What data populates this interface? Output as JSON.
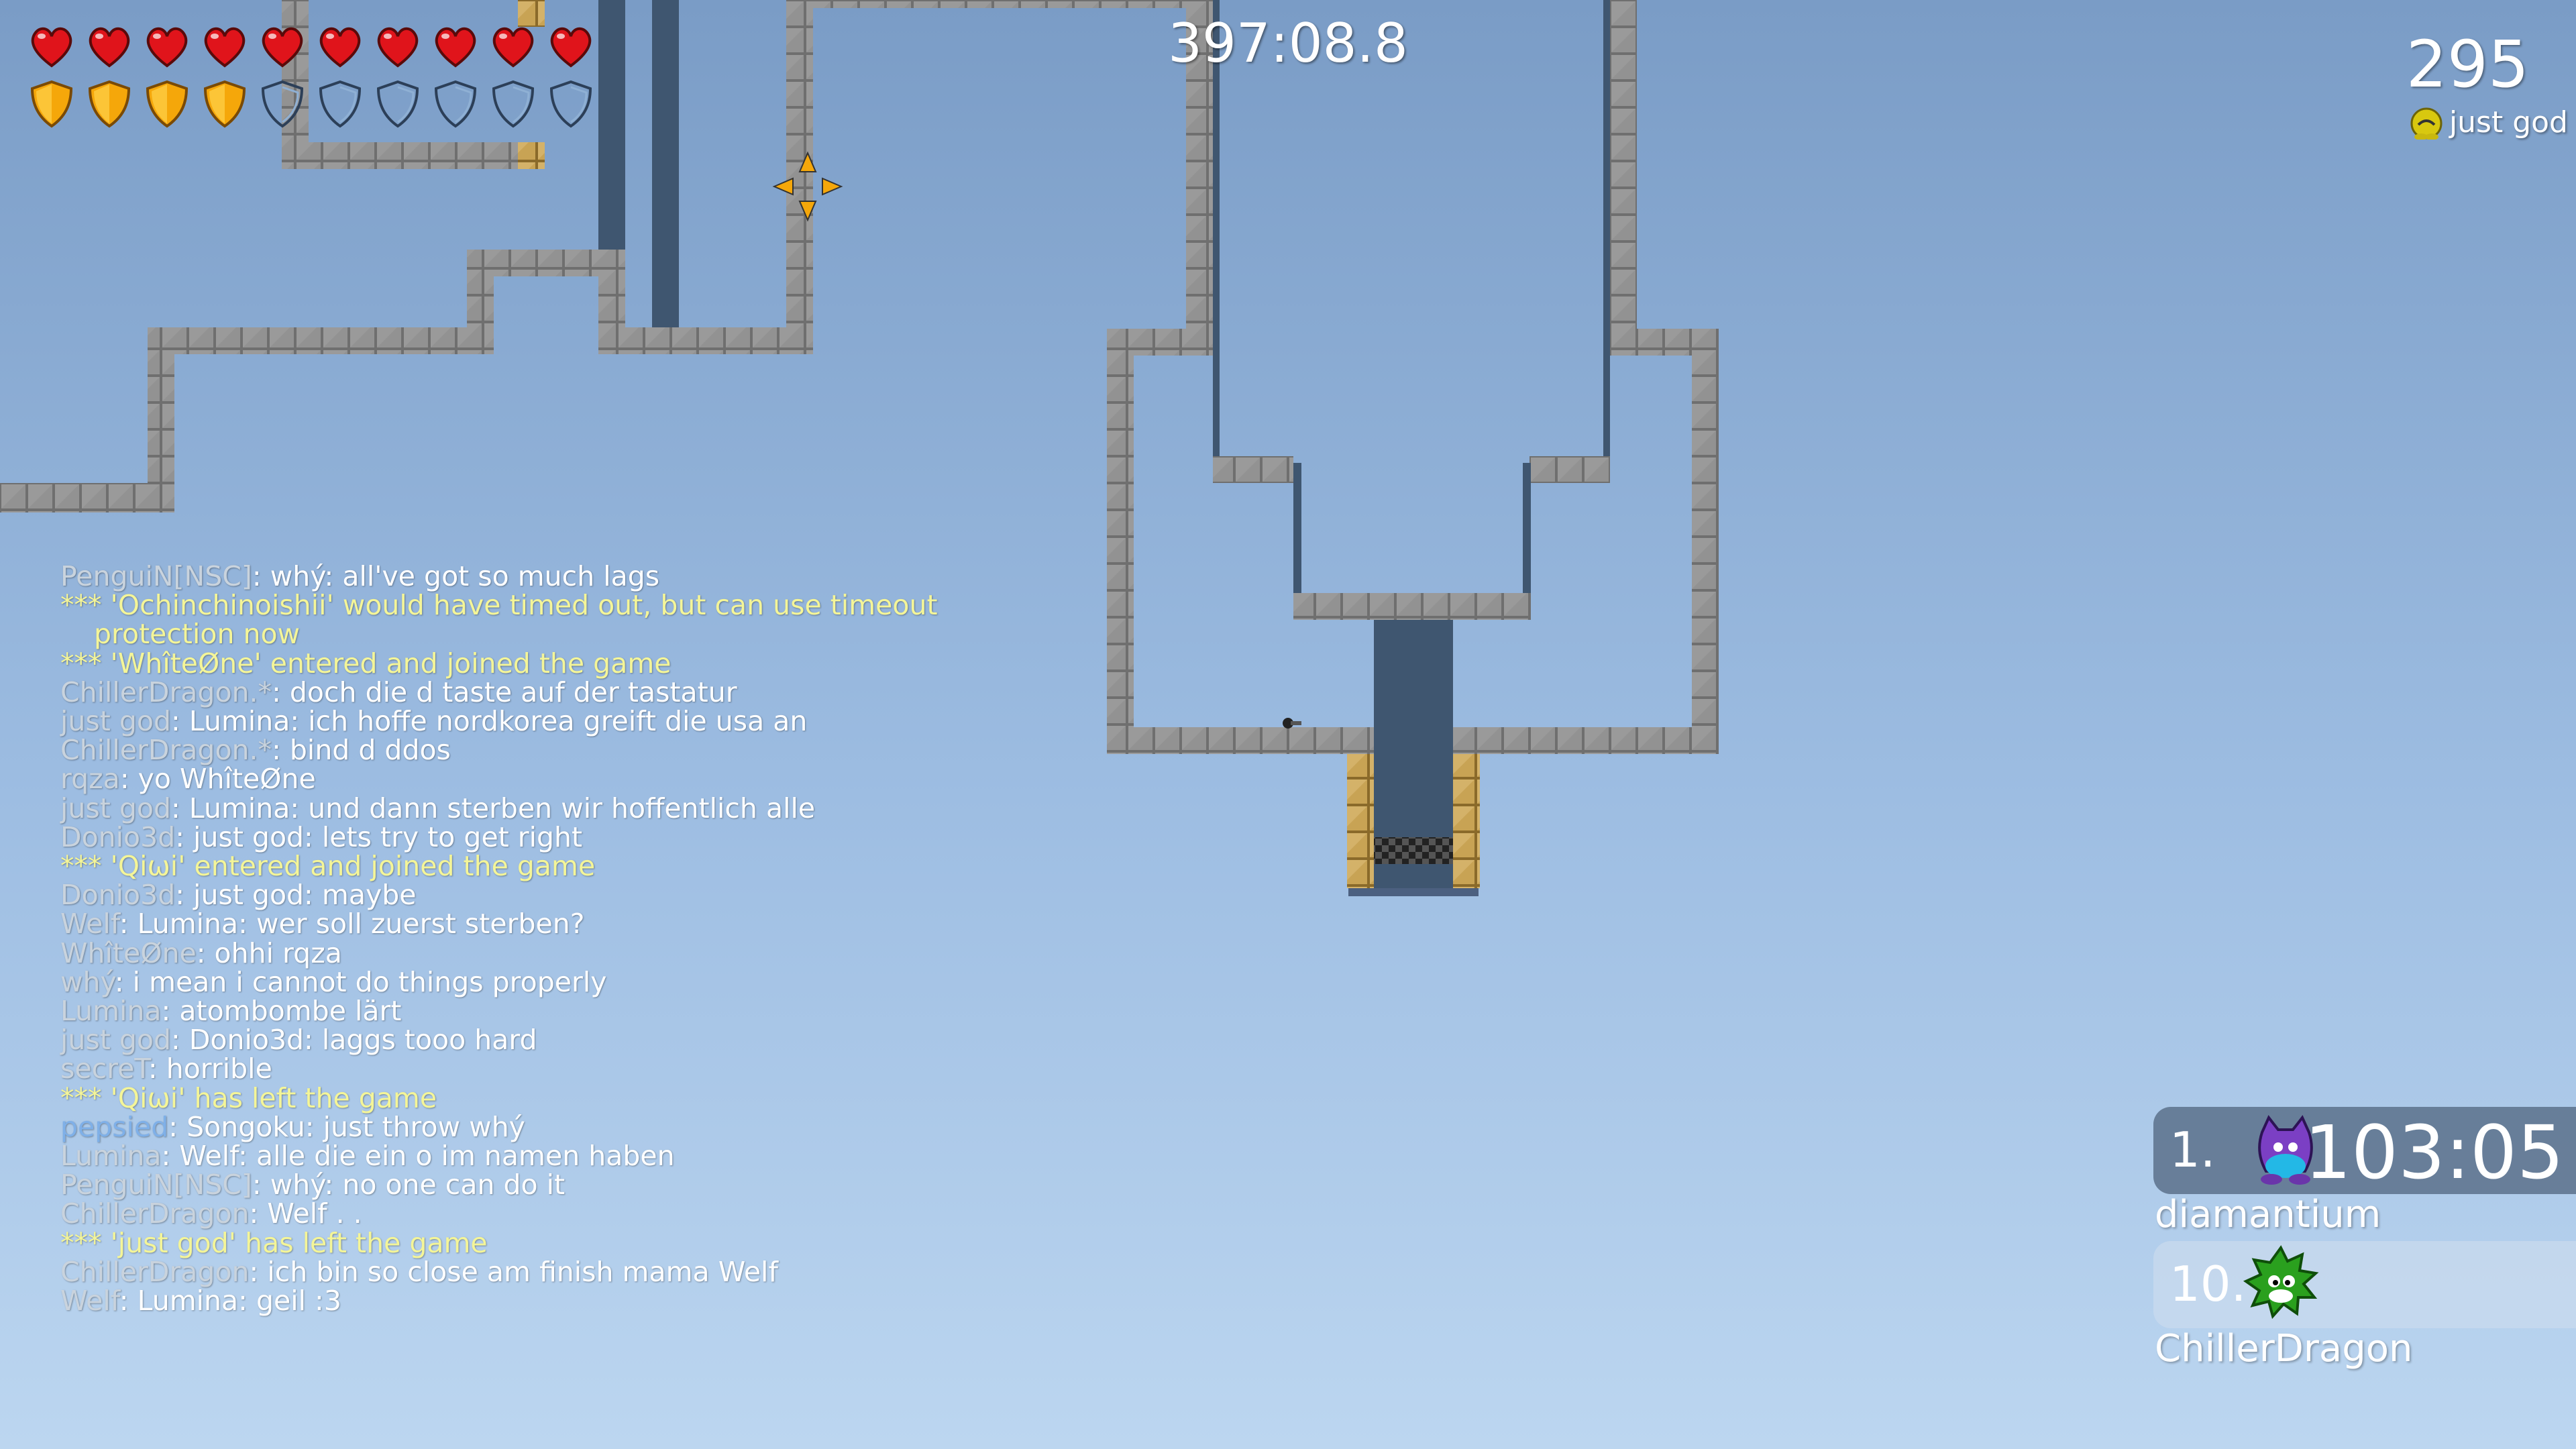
{
  "hud": {
    "health": {
      "current": 10,
      "max": 10
    },
    "armor": {
      "current": 4,
      "max": 10
    },
    "colors": {
      "heart": "#e0141b",
      "armor": "#f5a70a",
      "armor_empty": "#4a6c93"
    }
  },
  "race_timer": "397:08.8",
  "score": {
    "value": "295",
    "player": "just god"
  },
  "chat": [
    {
      "name": "PenguiN[NSC]",
      "text": ": whý: all've got so much lags"
    },
    {
      "system": "*** 'Ochinchinoishii' would have timed out, but can use timeout protection now"
    },
    {
      "system": "*** 'WhîteØne' entered and joined the game"
    },
    {
      "name": "ChillerDragon.*",
      "text": ": doch die d taste auf der tastatur"
    },
    {
      "name": "just god",
      "text": ": Lumina:  ich hoffe nordkorea greift die usa an"
    },
    {
      "name": "ChillerDragon.*",
      "text": ": bind d ddos"
    },
    {
      "name": "rqza",
      "text": ": yo WhîteØne"
    },
    {
      "name": "just god",
      "text": ": Lumina:  und dann sterben wir hoffentlich alle"
    },
    {
      "name": "Donio3d",
      "text": ": just god: lets try to get right"
    },
    {
      "system": "*** 'Qiωi' entered and joined the game"
    },
    {
      "name": "Donio3d",
      "text": ": just god: maybe"
    },
    {
      "name": "Welf",
      "text": ": Lumina: wer soll zuerst sterben?"
    },
    {
      "name": "WhîteØne",
      "text": ": ohhi rqza"
    },
    {
      "name": "whý",
      "text": ": i mean i cannot do things properly"
    },
    {
      "name": "Lumina",
      "text": ": atombombe lärt"
    },
    {
      "name": "just god",
      "text": ": Donio3d:  laggs tooo hard"
    },
    {
      "name": "secreT",
      "text": ": horrible"
    },
    {
      "system": "*** 'Qiωi' has left the game"
    },
    {
      "name": "pepsied",
      "text": ": Songoku: just throw whý",
      "highlight": true
    },
    {
      "name": "Lumina",
      "text": ": Welf:  alle die ein o im namen haben"
    },
    {
      "name": "PenguiN[NSC]",
      "text": ": whý: no one can do it"
    },
    {
      "name": "ChillerDragon",
      "text": ": Welf . ."
    },
    {
      "system": "*** 'just god' has left the game"
    },
    {
      "name": "ChillerDragon",
      "text": ": ich bin so close am finish mama Welf"
    },
    {
      "name": "Welf",
      "text": ": Lumina: geil :3"
    }
  ],
  "ranking": [
    {
      "rank": "1.",
      "time": "103:05",
      "player": "diamantium",
      "skin_color": "#7b3fc4",
      "skin_icon": "purple-cat-tee-icon"
    },
    {
      "rank": "10.",
      "time": "",
      "player": "ChillerDragon",
      "skin_color": "#2aa01e",
      "skin_icon": "green-spiky-tee-icon"
    }
  ],
  "colors": {
    "wall_tile": "#8a8a8a",
    "unhook_tile": "#c8a354",
    "dark_shaft": "#3f5670"
  }
}
